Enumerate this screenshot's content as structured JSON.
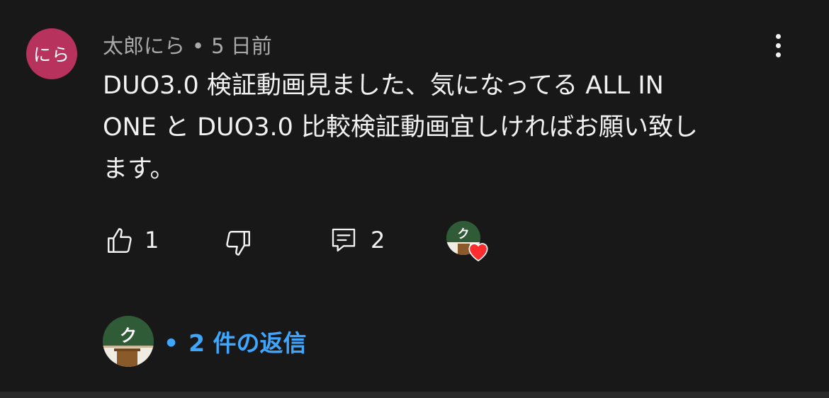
{
  "comment": {
    "author_avatar_text": "にら",
    "author_avatar_color": "#b8325e",
    "author_name": "太郎にら",
    "separator": "•",
    "timestamp": "5 日前",
    "text": "DUO3.0 検証動画見ました、気になってる ALL IN\nONE と DUO3.0 比較検証動画宜しければお願い致し\nます。",
    "more_icon": "more-vert-icon"
  },
  "actions": {
    "like_icon": "thumb-up-icon",
    "like_count": "1",
    "dislike_icon": "thumb-down-icon",
    "reply_icon": "comment-icon",
    "reply_count": "2",
    "creator_avatar_text": "ク",
    "heart_icon": "heart-icon",
    "heart_color": "#ff2d2d"
  },
  "replies": {
    "avatar_text": "ク",
    "separator": "•",
    "label": "2 件の返信",
    "link_color": "#3ea6ff"
  }
}
